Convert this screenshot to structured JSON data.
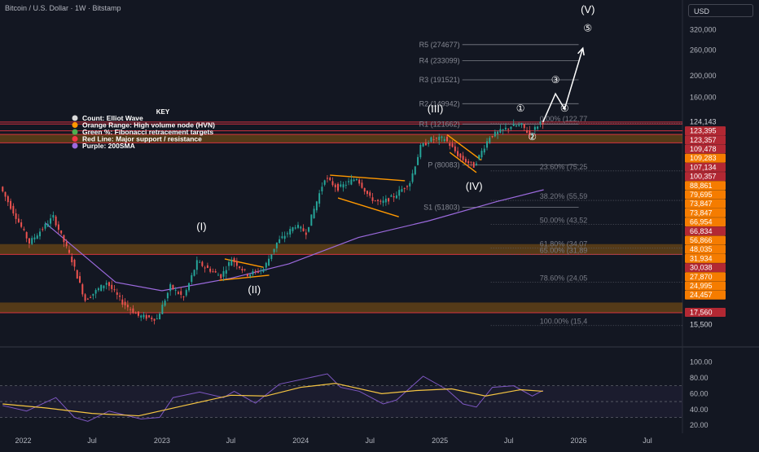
{
  "header": {
    "symbol_title": "Bitcoin / U.S. Dollar · 1W · Bitstamp",
    "currency_button": "USD"
  },
  "colors": {
    "background": "#131722",
    "candle_up": "#26a69a",
    "candle_down": "#ef5350",
    "hvn_band": "#ff9800",
    "support_line": "#f23645",
    "ma_line": "#9c6ade",
    "rsi_line": "#7e57c2",
    "rsi_ma": "#f5c542",
    "wave_text": "#ffffff"
  },
  "key": {
    "title": "KEY",
    "items": [
      {
        "label": "Count: Elliot Wave",
        "color": "#d9d9d9"
      },
      {
        "label": "Orange Range: High volume node (HVN)",
        "color": "#ff9800"
      },
      {
        "label": "Green %: Fibonacci retracement targets",
        "color": "#4caf50"
      },
      {
        "label": "Red Line: Major support / resistance",
        "color": "#f23645"
      },
      {
        "label": "Purple: 200SMA",
        "color": "#9c6ade"
      }
    ]
  },
  "chart_data": [
    {
      "type": "candlestick",
      "title": "Bitcoin / U.S. Dollar · 1W · Bitstamp",
      "y_scale": "log",
      "ylim": [
        13000,
        420000
      ],
      "x_range": [
        "2021-11-01",
        "2026-10-01"
      ],
      "x_ticks": [
        {
          "t": "2022-01-01",
          "label": "2022"
        },
        {
          "t": "2022-07-01",
          "label": "Jul"
        },
        {
          "t": "2023-01-01",
          "label": "2023"
        },
        {
          "t": "2023-07-01",
          "label": "Jul"
        },
        {
          "t": "2024-01-01",
          "label": "2024"
        },
        {
          "t": "2024-07-01",
          "label": "Jul"
        },
        {
          "t": "2025-01-01",
          "label": "2025"
        },
        {
          "t": "2025-07-01",
          "label": "Jul"
        },
        {
          "t": "2026-01-01",
          "label": "2026"
        },
        {
          "t": "2026-07-01",
          "label": "Jul"
        }
      ],
      "y_ticks": [
        320000,
        260000,
        200000,
        160000
      ],
      "price_path": [
        [
          "2021-11-08",
          64000
        ],
        [
          "2021-12-20",
          47000
        ],
        [
          "2022-01-24",
          36000
        ],
        [
          "2022-03-28",
          47000
        ],
        [
          "2022-05-16",
          30000
        ],
        [
          "2022-06-20",
          20000
        ],
        [
          "2022-08-15",
          24000
        ],
        [
          "2022-09-26",
          19500
        ],
        [
          "2022-11-07",
          17000
        ],
        [
          "2022-12-26",
          16500
        ],
        [
          "2023-01-30",
          23000
        ],
        [
          "2023-03-06",
          20500
        ],
        [
          "2023-04-10",
          29500
        ],
        [
          "2023-06-12",
          25500
        ],
        [
          "2023-07-10",
          30500
        ],
        [
          "2023-08-21",
          26000
        ],
        [
          "2023-10-02",
          27500
        ],
        [
          "2023-11-06",
          36000
        ],
        [
          "2023-12-25",
          43000
        ],
        [
          "2024-01-22",
          40000
        ],
        [
          "2024-03-11",
          70000
        ],
        [
          "2024-04-15",
          63000
        ],
        [
          "2024-06-03",
          70000
        ],
        [
          "2024-07-08",
          57000
        ],
        [
          "2024-08-05",
          54000
        ],
        [
          "2024-09-09",
          58000
        ],
        [
          "2024-10-21",
          67000
        ],
        [
          "2024-11-18",
          96000
        ],
        [
          "2024-12-16",
          104000
        ],
        [
          "2025-01-20",
          105000
        ],
        [
          "2025-03-03",
          86000
        ],
        [
          "2025-04-07",
          79000
        ],
        [
          "2025-05-19",
          107000
        ],
        [
          "2025-07-14",
          119000
        ],
        [
          "2025-08-11",
          120000
        ],
        [
          "2025-09-01",
          109000
        ],
        [
          "2025-09-29",
          124000
        ]
      ],
      "ma200_path": [
        [
          "2022-03-01",
          44000
        ],
        [
          "2022-09-01",
          24000
        ],
        [
          "2023-01-01",
          22000
        ],
        [
          "2023-07-01",
          25000
        ],
        [
          "2023-12-01",
          29000
        ],
        [
          "2024-06-01",
          38000
        ],
        [
          "2024-12-01",
          45000
        ],
        [
          "2025-06-01",
          55000
        ],
        [
          "2025-10-01",
          62000
        ]
      ],
      "pivots": [
        {
          "label": "R5 (274677)",
          "value": 274677
        },
        {
          "label": "R4 (233099)",
          "value": 233099
        },
        {
          "label": "R3 (191521)",
          "value": 191521
        },
        {
          "label": "R2 (149942)",
          "value": 149942
        },
        {
          "label": "R1 (121662)",
          "value": 121662
        },
        {
          "label": "P (80083)",
          "value": 80083
        },
        {
          "label": "S1 (51803)",
          "value": 51803
        }
      ],
      "fib_levels": [
        {
          "label": "0.00% (122,77",
          "value": 122770
        },
        {
          "label": "23.60% (75,25",
          "value": 75250
        },
        {
          "label": "38.20% (55,59",
          "value": 55590
        },
        {
          "label": "50.00% (43,52",
          "value": 43520
        },
        {
          "label": "61.80% (34,07",
          "value": 34070
        },
        {
          "label": "65.00% (31,89",
          "value": 31890
        },
        {
          "label": "78.60% (24,05",
          "value": 24050
        },
        {
          "label": "100.00% (15,4",
          "value": 15400
        }
      ],
      "hvn_zones": [
        [
          100357,
          109500
        ],
        [
          31934,
          35500
        ],
        [
          17560,
          19500
        ]
      ],
      "red_lines": [
        124143,
        121662,
        113500,
        109478,
        100357,
        31934,
        17560
      ],
      "price_labels": [
        {
          "value": 124143,
          "text": "124,143",
          "style": "plain"
        },
        {
          "value": 123395,
          "text": "123,395",
          "style": "red"
        },
        {
          "value": 123357,
          "text": "123,357",
          "style": "red"
        },
        {
          "value": 109478,
          "text": "109,478",
          "style": "red"
        },
        {
          "value": 109283,
          "text": "109,283",
          "style": "orange"
        },
        {
          "value": 107134,
          "text": "107,134",
          "style": "red"
        },
        {
          "value": 100357,
          "text": "100,357",
          "style": "red"
        },
        {
          "value": 88861,
          "text": "88,861",
          "style": "orange"
        },
        {
          "value": 79695,
          "text": "79,695",
          "style": "orange"
        },
        {
          "value": 73847,
          "text": "73,847",
          "style": "orange"
        },
        {
          "value": 73847,
          "text": "73,847",
          "style": "orange"
        },
        {
          "value": 66954,
          "text": "66,954",
          "style": "orange"
        },
        {
          "value": 66834,
          "text": "66,834",
          "style": "red"
        },
        {
          "value": 56866,
          "text": "56,866",
          "style": "orange"
        },
        {
          "value": 48035,
          "text": "48,035",
          "style": "orange"
        },
        {
          "value": 31934,
          "text": "31,934",
          "style": "orange"
        },
        {
          "value": 30038,
          "text": "30,038",
          "style": "red"
        },
        {
          "value": 27870,
          "text": "27,870",
          "style": "orange"
        },
        {
          "value": 24995,
          "text": "24,995",
          "style": "orange"
        },
        {
          "value": 24457,
          "text": "24,457",
          "style": "orange"
        },
        {
          "value": 17560,
          "text": "17,560",
          "style": "red"
        },
        {
          "value": 15500,
          "text": "15,500",
          "style": "plain"
        }
      ],
      "wave_labels": [
        {
          "text": "(I)",
          "t": "2023-04-15",
          "v": 41000
        },
        {
          "text": "(II)",
          "t": "2023-09-01",
          "v": 21500
        },
        {
          "text": "(III)",
          "t": "2024-12-20",
          "v": 137000
        },
        {
          "text": "(IV)",
          "t": "2025-04-01",
          "v": 62000
        },
        {
          "text": "(V)",
          "t": "2026-01-25",
          "v": 380000
        },
        {
          "text": "⑤",
          "t": "2026-01-25",
          "v": 315000
        },
        {
          "text": "①",
          "t": "2025-08-01",
          "v": 138000
        },
        {
          "text": "②",
          "t": "2025-09-01",
          "v": 103000
        },
        {
          "text": "③",
          "t": "2025-11-01",
          "v": 185000
        },
        {
          "text": "④",
          "t": "2025-11-25",
          "v": 138000
        }
      ],
      "projection_path": [
        [
          "2025-09-29",
          124000
        ],
        [
          "2025-11-01",
          166000
        ],
        [
          "2025-11-25",
          142000
        ],
        [
          "2026-01-12",
          265000
        ]
      ],
      "pattern_lines": [
        [
          [
            "2023-06-15",
            30500
          ],
          [
            "2023-09-25",
            28000
          ]
        ],
        [
          [
            "2023-06-01",
            24500
          ],
          [
            "2023-10-10",
            25800
          ]
        ],
        [
          [
            "2024-03-18",
            72000
          ],
          [
            "2024-10-01",
            68000
          ]
        ],
        [
          [
            "2024-04-08",
            57000
          ],
          [
            "2024-09-15",
            47000
          ]
        ],
        [
          [
            "2025-01-20",
            109000
          ],
          [
            "2025-04-20",
            84000
          ]
        ],
        [
          [
            "2025-01-27",
            91000
          ],
          [
            "2025-04-07",
            74000
          ]
        ]
      ]
    },
    {
      "type": "line",
      "title": "RSI",
      "ylim": [
        12,
        118
      ],
      "y_ticks": [
        100,
        80,
        60,
        40,
        20
      ],
      "bands": [
        30,
        50,
        70
      ],
      "series": [
        {
          "name": "",
          "points": [
            [
              "2021-11-08",
              45
            ],
            [
              "2022-01-10",
              38
            ],
            [
              "2022-03-28",
              55
            ],
            [
              "2022-05-16",
              30
            ],
            [
              "2022-06-20",
              25
            ],
            [
              "2022-08-15",
              38
            ],
            [
              "2022-09-26",
              33
            ],
            [
              "2022-11-07",
              28
            ],
            [
              "2022-12-26",
              30
            ],
            [
              "2023-01-30",
              55
            ],
            [
              "2023-04-10",
              62
            ],
            [
              "2023-06-12",
              55
            ],
            [
              "2023-07-10",
              63
            ],
            [
              "2023-09-04",
              48
            ],
            [
              "2023-11-06",
              72
            ],
            [
              "2024-03-11",
              85
            ],
            [
              "2024-04-15",
              68
            ],
            [
              "2024-06-03",
              63
            ],
            [
              "2024-08-05",
              47
            ],
            [
              "2024-09-09",
              52
            ],
            [
              "2024-11-18",
              82
            ],
            [
              "2025-01-20",
              65
            ],
            [
              "2025-03-03",
              47
            ],
            [
              "2025-04-07",
              43
            ],
            [
              "2025-05-19",
              68
            ],
            [
              "2025-07-14",
              70
            ],
            [
              "2025-09-01",
              57
            ],
            [
              "2025-09-29",
              64
            ]
          ]
        },
        {
          "name": "",
          "points": [
            [
              "2021-11-08",
              47
            ],
            [
              "2022-03-01",
              42
            ],
            [
              "2022-07-01",
              35
            ],
            [
              "2022-11-01",
              32
            ],
            [
              "2023-03-01",
              45
            ],
            [
              "2023-07-01",
              58
            ],
            [
              "2023-10-01",
              57
            ],
            [
              "2024-01-01",
              68
            ],
            [
              "2024-04-01",
              73
            ],
            [
              "2024-08-01",
              60
            ],
            [
              "2024-11-01",
              64
            ],
            [
              "2025-02-01",
              66
            ],
            [
              "2025-05-01",
              57
            ],
            [
              "2025-08-01",
              65
            ],
            [
              "2025-09-29",
              63
            ]
          ]
        }
      ]
    }
  ]
}
